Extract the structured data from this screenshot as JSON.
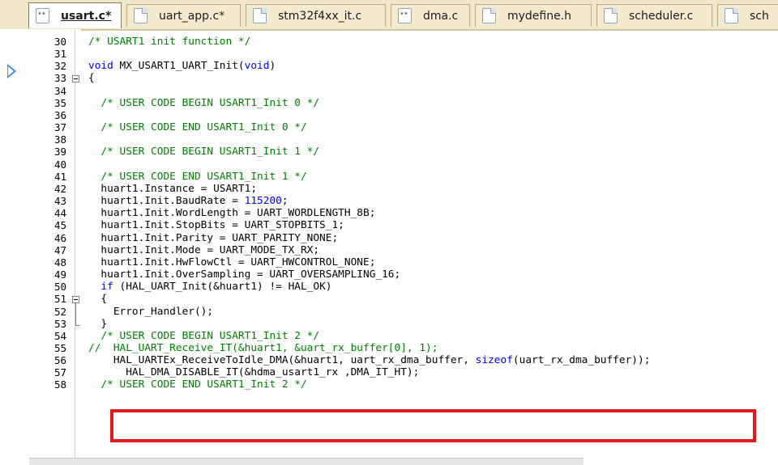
{
  "tabs": [
    {
      "label": "usart.c*",
      "icon": "c-file-icon",
      "active": true
    },
    {
      "label": "uart_app.c*",
      "icon": "file-icon",
      "active": false
    },
    {
      "label": "stm32f4xx_it.c",
      "icon": "file-icon",
      "active": false
    },
    {
      "label": "dma.c",
      "icon": "c-file-icon",
      "active": false
    },
    {
      "label": "mydefine.h",
      "icon": "file-icon",
      "active": false
    },
    {
      "label": "scheduler.c",
      "icon": "file-icon",
      "active": false
    },
    {
      "label": "sch",
      "icon": "file-icon",
      "active": false
    }
  ],
  "editor": {
    "lines": [
      {
        "n": "30",
        "text": "/* USART1 init function */"
      },
      {
        "n": "31",
        "text": ""
      },
      {
        "n": "32",
        "text": "void MX_USART1_UART_Init(void)"
      },
      {
        "n": "33",
        "text": "{"
      },
      {
        "n": "34",
        "text": ""
      },
      {
        "n": "35",
        "text": "  /* USER CODE BEGIN USART1_Init 0 */"
      },
      {
        "n": "36",
        "text": ""
      },
      {
        "n": "37",
        "text": "  /* USER CODE END USART1_Init 0 */"
      },
      {
        "n": "38",
        "text": ""
      },
      {
        "n": "39",
        "text": "  /* USER CODE BEGIN USART1_Init 1 */"
      },
      {
        "n": "40",
        "text": ""
      },
      {
        "n": "41",
        "text": "  /* USER CODE END USART1_Init 1 */"
      },
      {
        "n": "42",
        "text": "  huart1.Instance = USART1;"
      },
      {
        "n": "43",
        "text": "  huart1.Init.BaudRate = 115200;"
      },
      {
        "n": "44",
        "text": "  huart1.Init.WordLength = UART_WORDLENGTH_8B;"
      },
      {
        "n": "45",
        "text": "  huart1.Init.StopBits = UART_STOPBITS_1;"
      },
      {
        "n": "46",
        "text": "  huart1.Init.Parity = UART_PARITY_NONE;"
      },
      {
        "n": "47",
        "text": "  huart1.Init.Mode = UART_MODE_TX_RX;"
      },
      {
        "n": "48",
        "text": "  huart1.Init.HwFlowCtl = UART_HWCONTROL_NONE;"
      },
      {
        "n": "49",
        "text": "  huart1.Init.OverSampling = UART_OVERSAMPLING_16;"
      },
      {
        "n": "50",
        "text": "  if (HAL_UART_Init(&huart1) != HAL_OK)"
      },
      {
        "n": "51",
        "text": "  {"
      },
      {
        "n": "52",
        "text": "    Error_Handler();"
      },
      {
        "n": "53",
        "text": "  }"
      },
      {
        "n": "54",
        "text": "  /* USER CODE BEGIN USART1_Init 2 */"
      },
      {
        "n": "55",
        "text": "//  HAL_UART_Receive_IT(&huart1, &uart_rx_buffer[0], 1);"
      },
      {
        "n": "56",
        "text": "    HAL_UARTEx_ReceiveToIdle_DMA(&huart1, uart_rx_dma_buffer, sizeof(uart_rx_dma_buffer));"
      },
      {
        "n": "57",
        "text": "      HAL_DMA_DISABLE_IT(&hdma_usart1_rx ,DMA_IT_HT);"
      },
      {
        "n": "58",
        "text": "  /* USER CODE END USART1_Init 2 */"
      }
    ]
  },
  "colors": {
    "keyword": "#0000ff",
    "comment": "#008000",
    "highlight_box": "#e01b1b",
    "execution_arrow": "#2f8de0"
  }
}
